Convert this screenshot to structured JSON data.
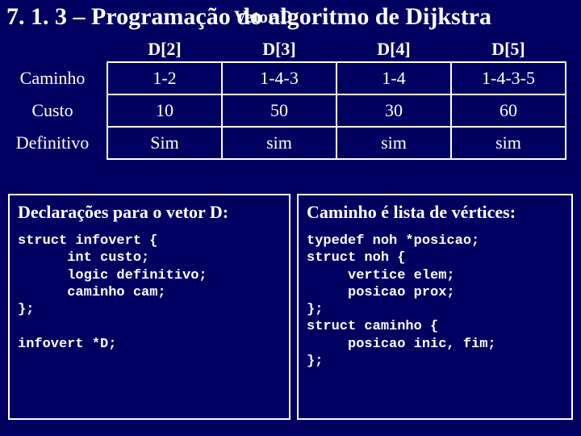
{
  "title": "7. 1. 3 – Programação do algoritmo de Dijkstra",
  "overlay": "Vetor D",
  "table": {
    "corner": "",
    "col_headers": [
      "D[2]",
      "D[3]",
      "D[4]",
      "D[5]"
    ],
    "rows": [
      {
        "label": "Caminho",
        "cells": [
          "1-2",
          "1-4-3",
          "1-4",
          "1-4-3-5"
        ]
      },
      {
        "label": "Custo",
        "cells": [
          "10",
          "50",
          "30",
          "60"
        ]
      },
      {
        "label": "Definitivo",
        "cells": [
          "Sim",
          "sim",
          "sim",
          "sim"
        ]
      }
    ]
  },
  "left_box": {
    "header": "Declarações para o vetor D:",
    "code": "struct infovert {\n      int custo;\n      logic definitivo;\n      caminho cam;\n};\n\ninfovert *D;"
  },
  "right_box": {
    "header": "Caminho é lista de vértices:",
    "code": "typedef noh *posicao;\nstruct noh {\n     vertice elem;\n     posicao prox;\n};\nstruct caminho {\n     posicao inic, fim;\n};"
  }
}
